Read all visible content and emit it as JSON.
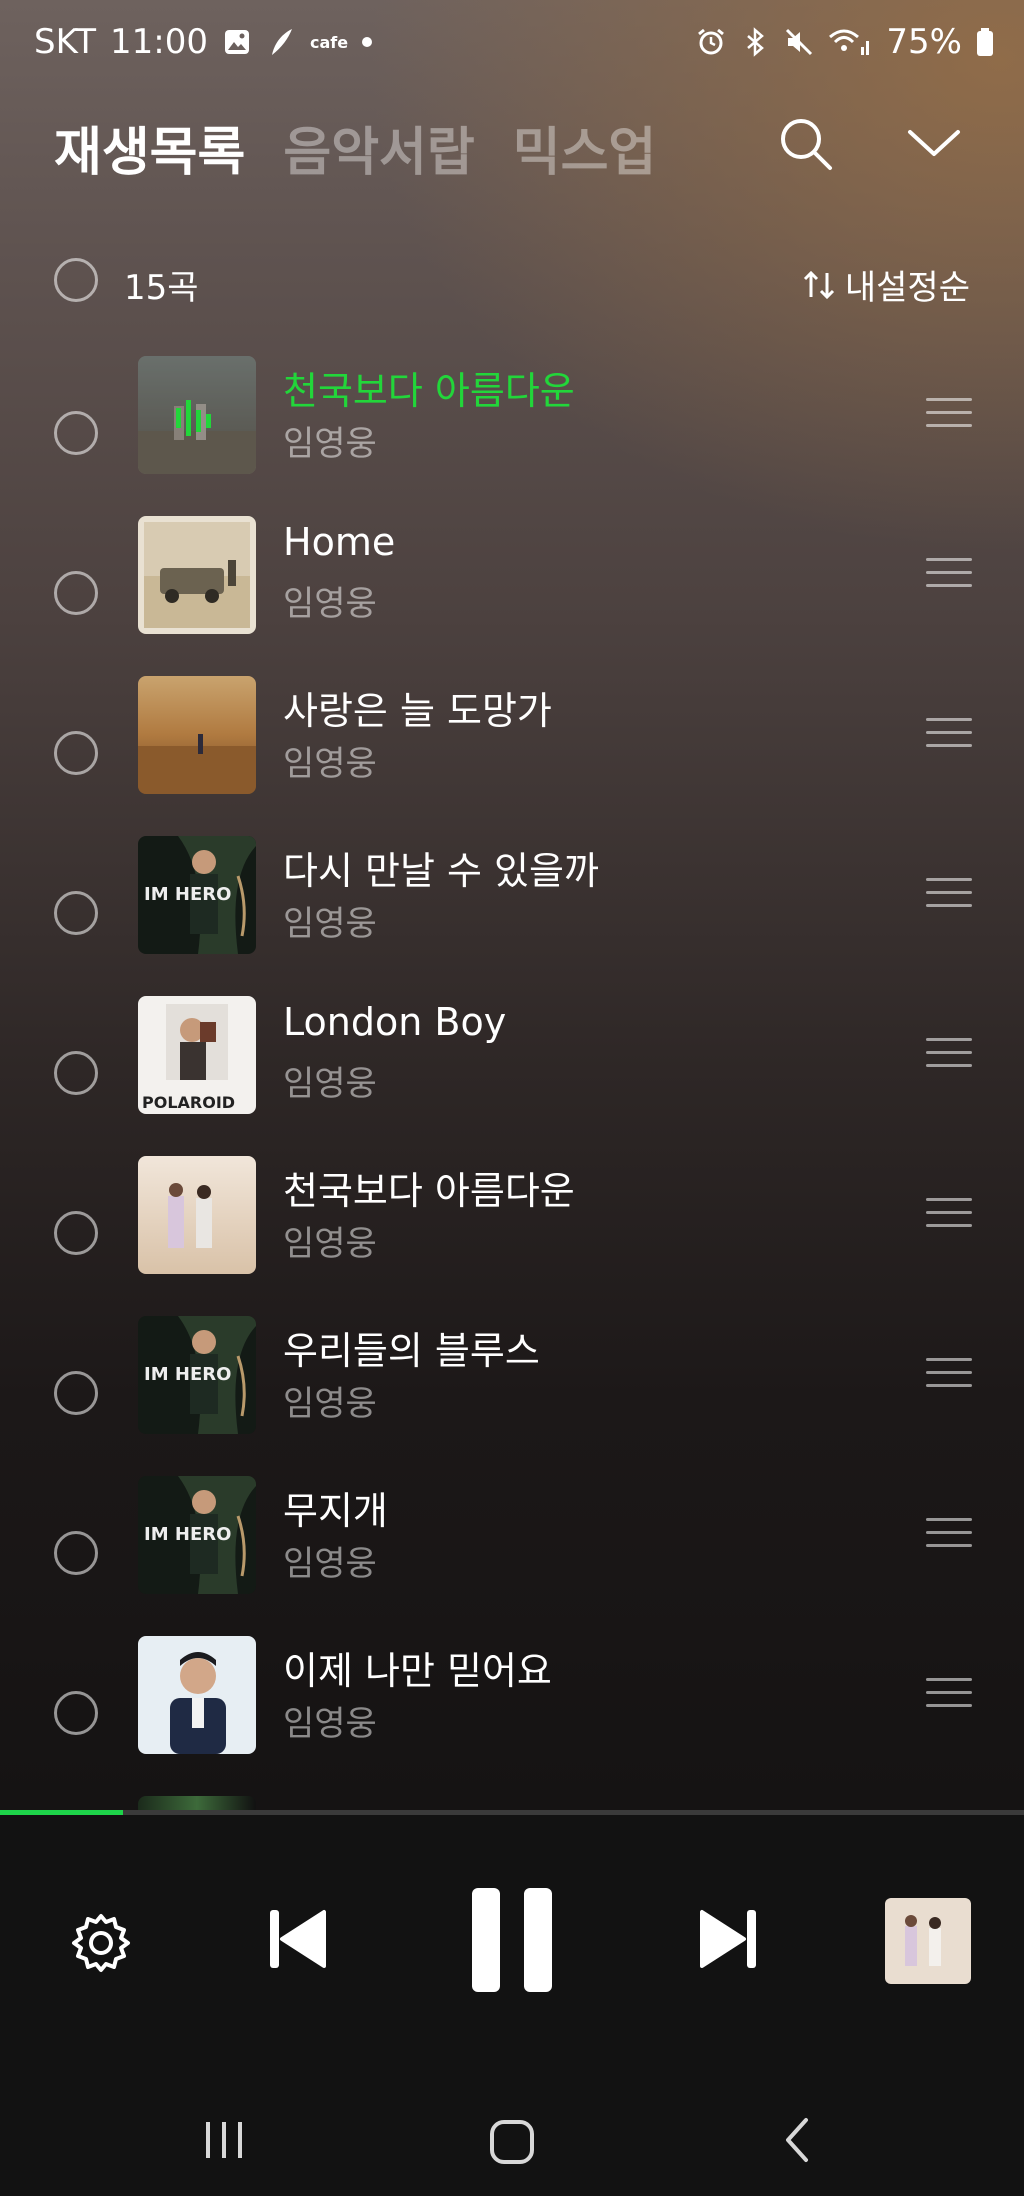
{
  "status": {
    "carrier": "SKT",
    "time": "11:00",
    "cafe_label": "cafe",
    "battery": "75%"
  },
  "tabs": [
    {
      "label": "재생목록",
      "active": true
    },
    {
      "label": "음악서랍",
      "active": false
    },
    {
      "label": "믹스업",
      "active": false
    }
  ],
  "list_header": {
    "count": "15곡",
    "sort_label": "내설정순"
  },
  "tracks": [
    {
      "title": "천국보다 아름다운",
      "artist": "임영웅",
      "playing": true
    },
    {
      "title": "Home",
      "artist": "임영웅"
    },
    {
      "title": "사랑은 늘 도망가",
      "artist": "임영웅"
    },
    {
      "title": "다시 만날 수 있을까",
      "artist": "임영웅"
    },
    {
      "title": "London Boy",
      "artist": "임영웅"
    },
    {
      "title": "천국보다 아름다운",
      "artist": "임영웅"
    },
    {
      "title": "우리들의 블루스",
      "artist": "임영웅"
    },
    {
      "title": "무지개",
      "artist": "임영웅"
    },
    {
      "title": "이제 나만 믿어요",
      "artist": "임영웅"
    }
  ],
  "album_art_text": {
    "im_hero": "IM HERO",
    "polaroid": "POLAROID"
  },
  "player": {
    "progress": 0.12,
    "accent": "#1ed34a"
  },
  "icons": [
    "search-icon",
    "chevron-down-icon",
    "sort-icon",
    "drag-handle-icon",
    "settings-icon",
    "previous-icon",
    "pause-icon",
    "next-icon",
    "recents-icon",
    "home-icon",
    "back-icon"
  ]
}
